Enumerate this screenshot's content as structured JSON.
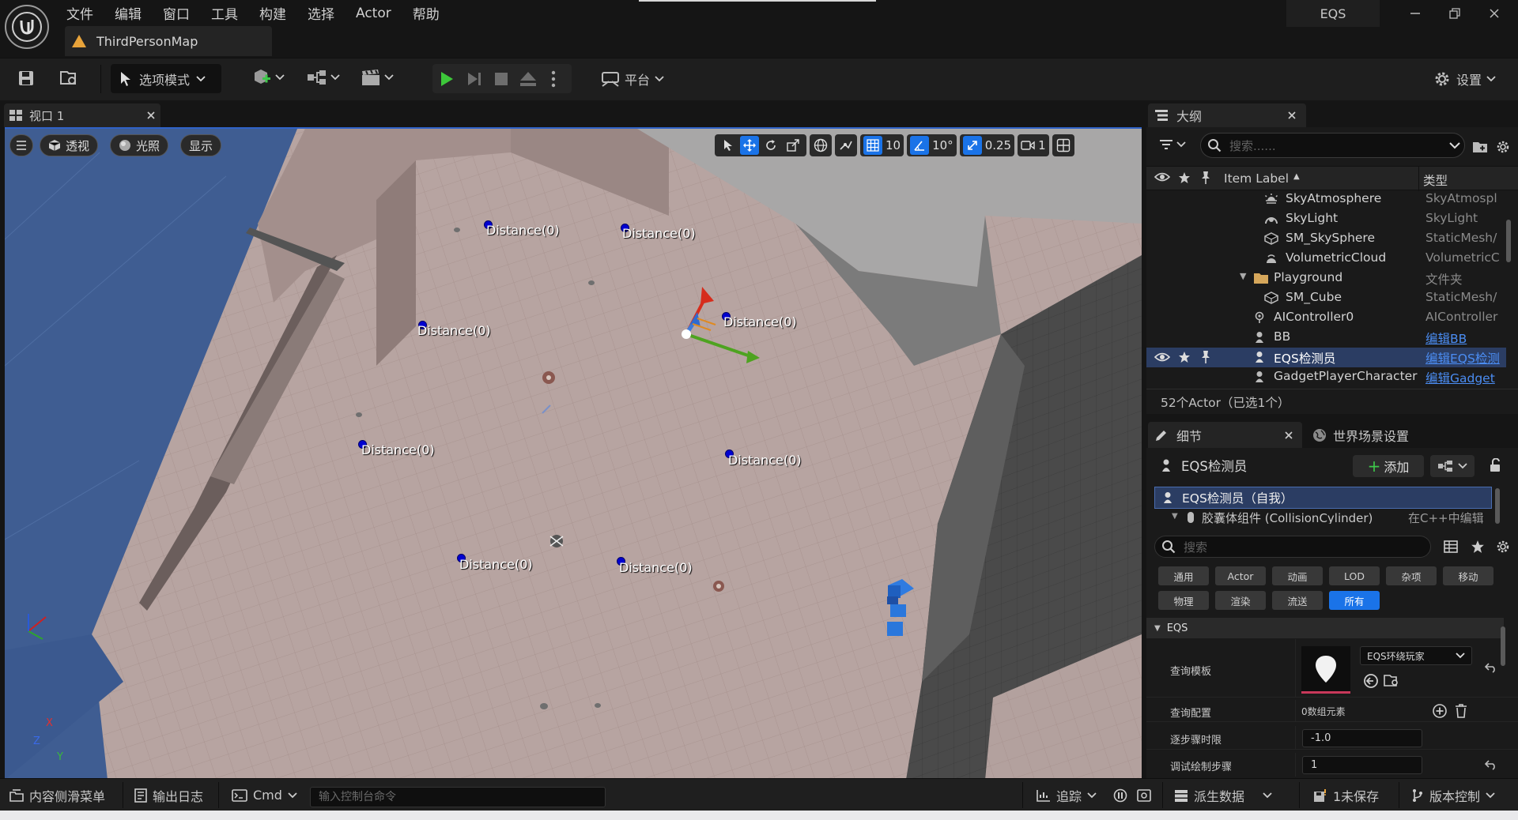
{
  "menu": [
    "文件",
    "编辑",
    "窗口",
    "工具",
    "构建",
    "选择",
    "Actor",
    "帮助"
  ],
  "map_tab": "ThirdPersonMap",
  "window_title": "EQS",
  "toolbar": {
    "mode_label": "选项模式",
    "platform_label": "平台",
    "settings_label": "设置"
  },
  "viewport": {
    "tab_label": "视口 1",
    "perspective_label": "透视",
    "lighting_label": "光照",
    "show_label": "显示",
    "grid_snap": "10",
    "rotation_snap": "10°",
    "scale_snap": "0.25",
    "camera_speed": "1",
    "distance_labels": [
      "Distance(0)",
      "Distance(0)",
      "Distance(0)",
      "Distance(0)",
      "Distance(0)",
      "Distance(0)",
      "Distance(0)",
      "Distance(0)"
    ],
    "axis_labels": {
      "x": "X",
      "y": "Y",
      "z": "Z"
    }
  },
  "outliner": {
    "tab_label": "大纲",
    "search_placeholder": "搜索......",
    "col_label": "Item Label",
    "col_type": "类型",
    "rows": [
      {
        "label": "SkyAtmosphere",
        "type": "SkyAtmospl",
        "link": false,
        "selected": false
      },
      {
        "label": "SkyLight",
        "type": "SkyLight",
        "link": false,
        "selected": false
      },
      {
        "label": "SM_SkySphere",
        "type": "StaticMesh/",
        "link": false,
        "selected": false
      },
      {
        "label": "VolumetricCloud",
        "type": "VolumetricC",
        "link": false,
        "selected": false
      },
      {
        "label": "Playground",
        "type": "文件夹",
        "link": false,
        "selected": false
      },
      {
        "label": "SM_Cube",
        "type": "StaticMesh/",
        "link": false,
        "selected": false
      },
      {
        "label": "AIController0",
        "type": "AIController",
        "link": false,
        "selected": false
      },
      {
        "label": "BB",
        "type": "编辑BB",
        "link": true,
        "selected": false
      },
      {
        "label": "EQS检测员",
        "type": "编辑EQS检测",
        "link": true,
        "selected": true
      },
      {
        "label": "GadgetPlayerCharacter",
        "type": "编辑Gadget",
        "link": true,
        "selected": false
      }
    ],
    "status": "52个Actor（已选1个）"
  },
  "details": {
    "tab_label": "细节",
    "world_tab_label": "世界场景设置",
    "actor_name": "EQS检测员",
    "add_label": "添加",
    "component_self": "EQS检测员（自我）",
    "component_child": "胶囊体组件 (CollisionCylinder)",
    "component_child_note": "在C++中编辑",
    "search_placeholder": "搜索",
    "categories_row1": [
      "通用",
      "Actor",
      "动画",
      "LOD",
      "杂项",
      "移动"
    ],
    "categories_row2": [
      "物理",
      "渲染",
      "流送",
      "所有"
    ],
    "section": "EQS",
    "props": {
      "query_template_label": "查询模板",
      "query_template_value": "EQS环绕玩家",
      "query_config_label": "查询配置",
      "query_config_value": "0数组元素",
      "step_time_label": "逐步骤时限",
      "step_time_value": "-1.0",
      "debug_step_label": "调试绘制步骤",
      "debug_step_value": "1"
    }
  },
  "statusbar": {
    "content_drawer": "内容侧滑菜单",
    "output_log": "输出日志",
    "cmd": "Cmd",
    "console_placeholder": "输入控制台命令",
    "trace": "追踪",
    "derived_data": "派生数据",
    "unsaved": "1未保存",
    "source_control": "版本控制"
  }
}
